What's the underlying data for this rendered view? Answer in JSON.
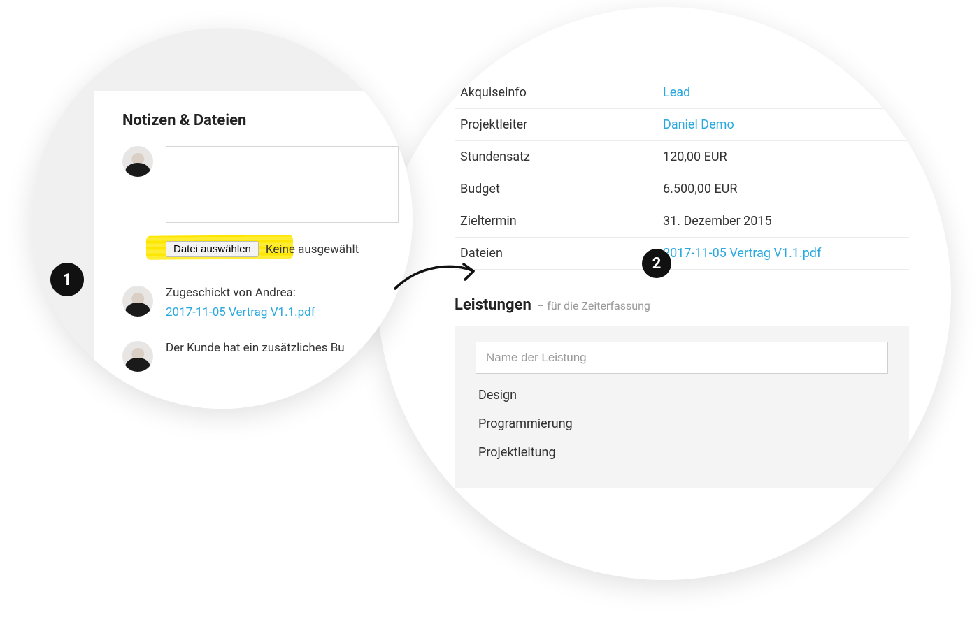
{
  "left": {
    "heading": "Notizen & Dateien",
    "file_button": "Datei auswählen",
    "file_status": "Keine ausgewählt",
    "notes": [
      {
        "text": "Zugeschickt von Andrea:",
        "attachment": "2017-11-05 Vertrag V1.1.pdf"
      },
      {
        "text": "Der Kunde hat ein zusätzliches Bu"
      }
    ]
  },
  "right": {
    "rows": [
      {
        "label": "Akquiseinfo",
        "value": "Lead",
        "link": true
      },
      {
        "label": "Projektleiter",
        "value": "Daniel Demo",
        "link": true
      },
      {
        "label": "Stundensatz",
        "value": "120,00 EUR",
        "link": false
      },
      {
        "label": "Budget",
        "value": "6.500,00 EUR",
        "link": false
      },
      {
        "label": "Zieltermin",
        "value": "31. Dezember 2015",
        "link": false
      },
      {
        "label": "Dateien",
        "value": "2017-11-05 Vertrag V1.1.pdf",
        "link": true
      }
    ],
    "section_title": "Leistungen",
    "section_sub": "– für die Zeiterfassung",
    "service_placeholder": "Name der Leistung",
    "services": [
      "Design",
      "Programmierung",
      "Projektleitung"
    ]
  },
  "badges": {
    "one": "1",
    "two": "2"
  }
}
